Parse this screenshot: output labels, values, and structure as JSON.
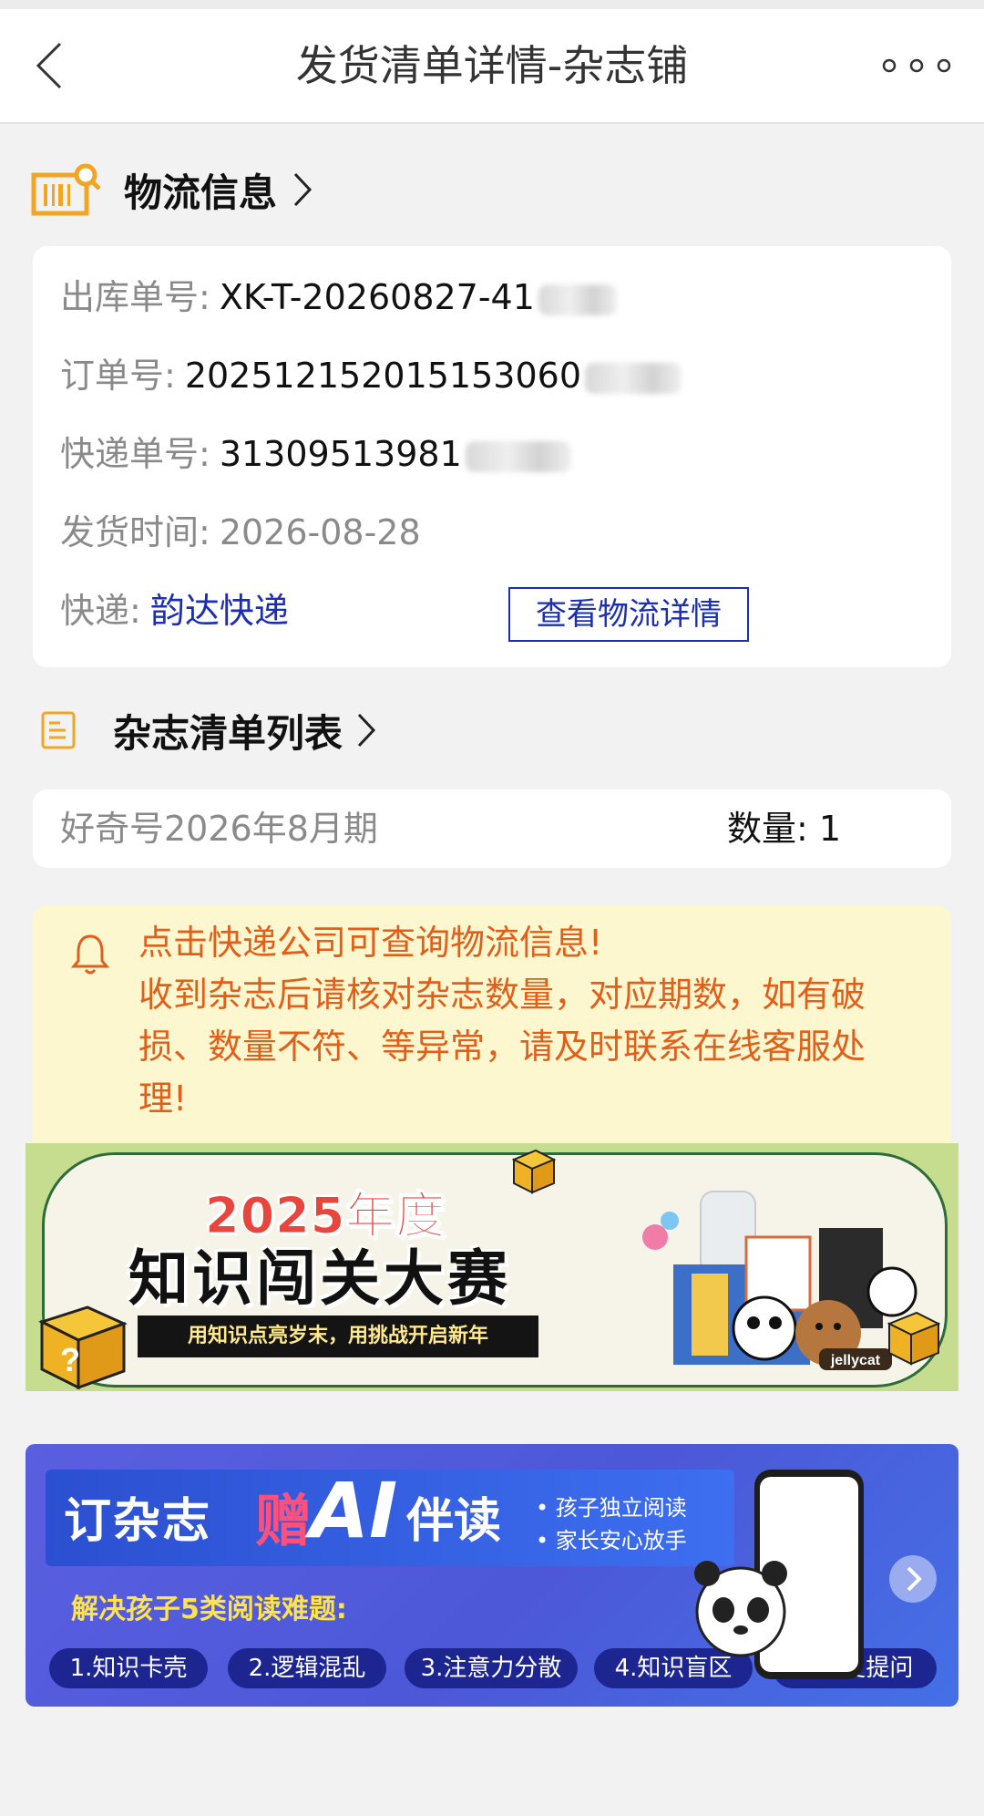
{
  "navbar": {
    "title": "发货清单详情-杂志铺",
    "back_icon": "chevron-left-icon",
    "more_icon": "more-dots-icon"
  },
  "logistics": {
    "section_title": "物流信息",
    "outbound_label": "出库单号:",
    "outbound_value": "XK-T-20260827-41",
    "order_label": "订单号:",
    "order_value": "202512152015153060",
    "tracking_label": "快递单号:",
    "tracking_value": "31309513981",
    "ship_time_label": "发货时间:",
    "ship_time_value": "2026-08-28",
    "courier_label": "快递:",
    "courier_value": "韵达快递",
    "detail_button": "查看物流详情"
  },
  "magazines": {
    "section_title": "杂志清单列表",
    "items": [
      {
        "name": "好奇号2026年8月期",
        "qty_label": "数量:",
        "qty": "1"
      }
    ]
  },
  "notice": {
    "lines": [
      "点击快递公司可查询物流信息!",
      "收到杂志后请核对杂志数量，对应期数，如有破",
      "损、数量不符、等异常，请及时联系在线客服处",
      "理!"
    ],
    "color": "#e0601b"
  },
  "banner_contest": {
    "year_title": "2025年度",
    "main_title": "知识闯关大赛",
    "subtitle": "用知识点亮岁末，用挑战开启新年",
    "brand": "jellycat"
  },
  "banner_ai": {
    "t1": "订杂志",
    "t2": "赠",
    "t3": "AI",
    "t4": "伴读",
    "bullets": [
      "• 孩子独立阅读",
      "• 家长安心放手"
    ],
    "problems_title": "解决孩子5类阅读难题:",
    "problems": [
      "1.知识卡壳",
      "2.逻辑混乱",
      "3.注意力分散",
      "4.知识盲区",
      "5.重复提问"
    ]
  },
  "colors": {
    "link_blue": "#1c2fb3",
    "section_icon_orange": "#f0a623",
    "label_gray": "#8a8a8a"
  }
}
